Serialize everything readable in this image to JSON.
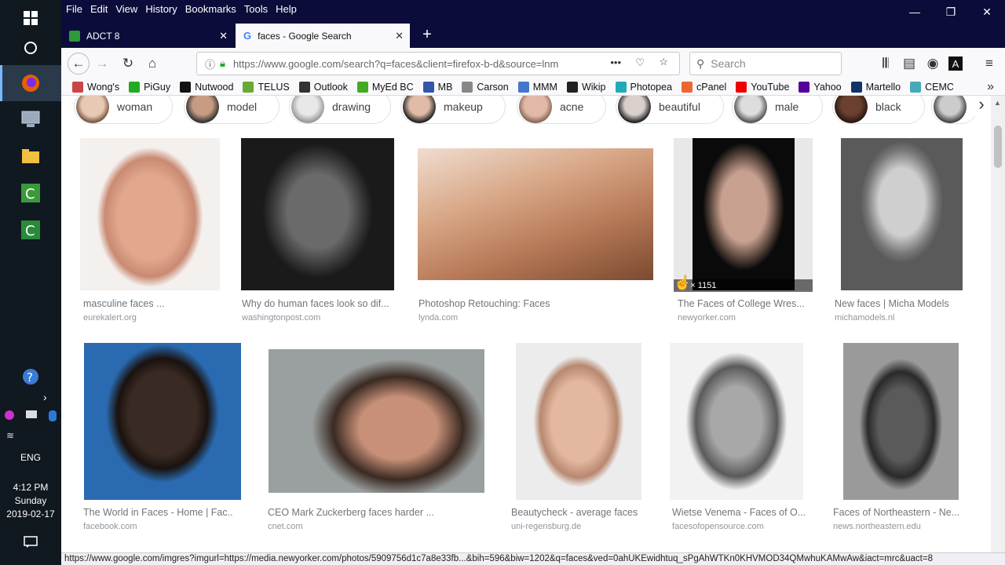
{
  "taskbar": {
    "lang": "ENG",
    "time": "4:12 PM",
    "day": "Sunday",
    "date": "2019-02-17"
  },
  "menu": [
    "File",
    "Edit",
    "View",
    "History",
    "Bookmarks",
    "Tools",
    "Help"
  ],
  "tabs": [
    {
      "title": "ADCT 8",
      "icon": "green-app-icon"
    },
    {
      "title": "faces - Google Search",
      "icon": "google-icon"
    }
  ],
  "nav": {
    "url": "https://www.google.com/search?q=faces&client=firefox-b-d&source=lnm",
    "search_placeholder": "Search"
  },
  "bookmarks": [
    {
      "label": "Wong's",
      "color": "#c44"
    },
    {
      "label": "PiGuy",
      "color": "#2a2"
    },
    {
      "label": "Nutwood",
      "color": "#111"
    },
    {
      "label": "TELUS",
      "color": "#6a3"
    },
    {
      "label": "Outlook",
      "color": "#333"
    },
    {
      "label": "MyEd BC",
      "color": "#4a2"
    },
    {
      "label": "MB",
      "color": "#35a"
    },
    {
      "label": "Carson",
      "color": "#888"
    },
    {
      "label": "MMM",
      "color": "#47c"
    },
    {
      "label": "Wikip",
      "color": "#222"
    },
    {
      "label": "Photopea",
      "color": "#2ab"
    },
    {
      "label": "cPanel",
      "color": "#e63"
    },
    {
      "label": "YouTube",
      "color": "#e00"
    },
    {
      "label": "Yahoo",
      "color": "#509"
    },
    {
      "label": "Martello",
      "color": "#136"
    },
    {
      "label": "CEMC",
      "color": "#4ab"
    }
  ],
  "chips": [
    "woman",
    "model",
    "drawing",
    "makeup",
    "acne",
    "beautiful",
    "male",
    "black"
  ],
  "row1": [
    {
      "caption": "masculine faces ...",
      "domain": "eurekalert.org"
    },
    {
      "caption": "Why do human faces look so dif...",
      "domain": "washingtonpost.com"
    },
    {
      "caption": "Photoshop Retouching: Faces",
      "domain": "lynda.com"
    },
    {
      "caption": "The Faces of College Wres...",
      "domain": "newyorker.com"
    },
    {
      "caption": "New faces | Micha Models",
      "domain": "michamodels.nl"
    }
  ],
  "row2": [
    {
      "caption": "The World in Faces - Home | Fac...",
      "domain": "facebook.com"
    },
    {
      "caption": "CEO Mark Zuckerberg faces harder ...",
      "domain": "cnet.com"
    },
    {
      "caption": "Beautycheck - average faces",
      "domain": "uni-regensburg.de"
    },
    {
      "caption": "Wietse Venema - Faces of O...",
      "domain": "facesofopensource.com"
    },
    {
      "caption": "Faces of Northeastern - Ne...",
      "domain": "news.northeastern.edu"
    }
  ],
  "hover_dims": "57 × 1151",
  "status_url": "https://www.google.com/imgres?imgurl=https://media.newyorker.com/photos/5909756d1c7a8e33fb...&bih=596&biw=1202&q=faces&ved=0ahUKEwidhtuq_sPgAhWTKn0KHVMOD34QMwhuKAMwAw&iact=mrc&uact=8"
}
